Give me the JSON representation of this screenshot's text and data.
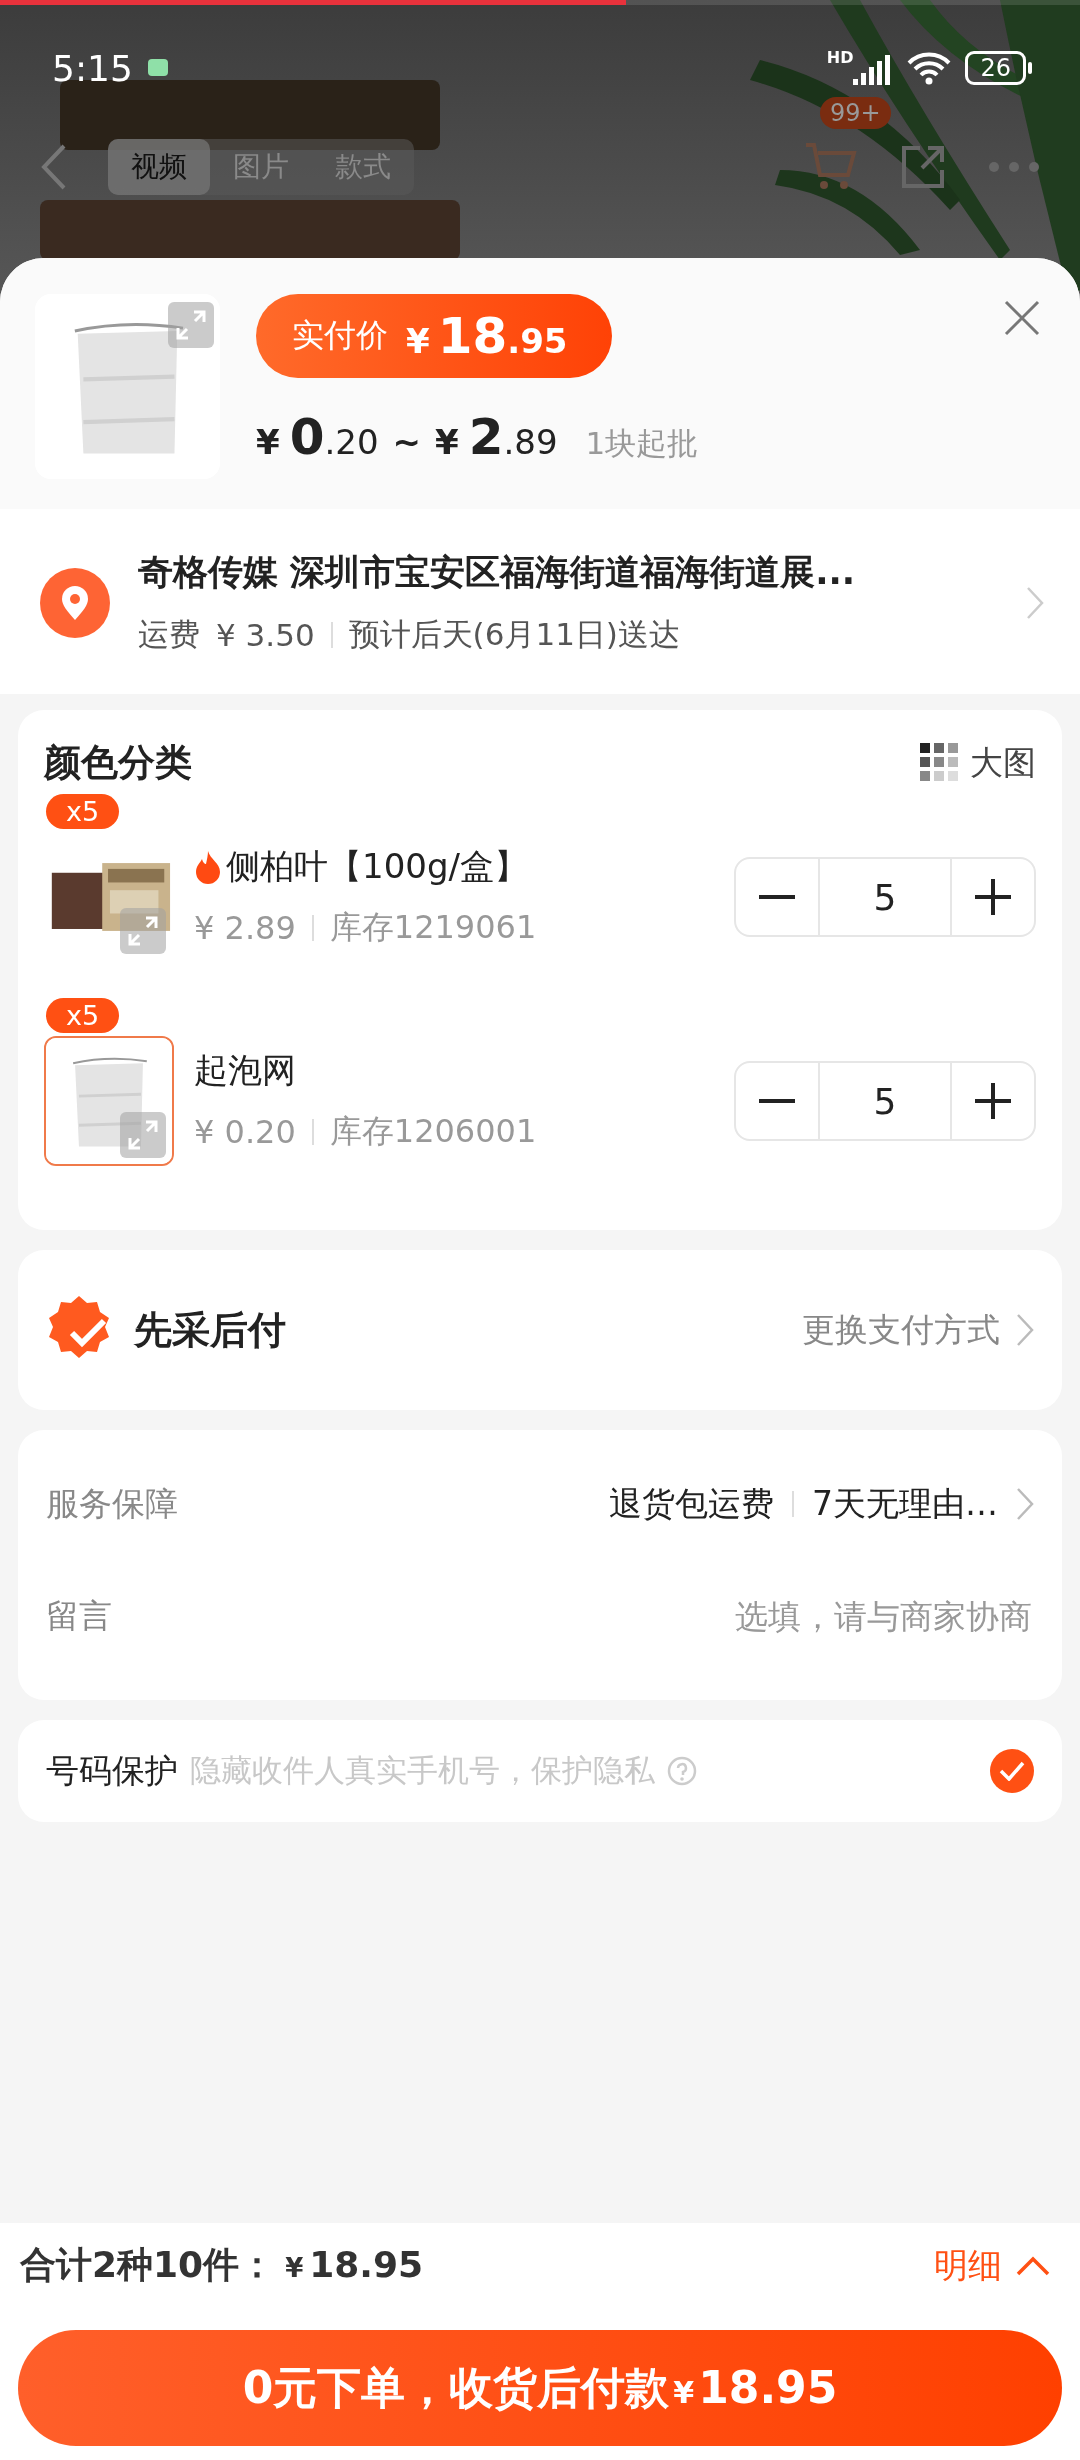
{
  "video_progress": {
    "level": 0.58
  },
  "status_bar": {
    "time": "5:15",
    "network": "HD",
    "battery": "26"
  },
  "media_tabs": [
    {
      "label": "视频",
      "selected": true
    },
    {
      "label": "图片",
      "selected": false
    },
    {
      "label": "款式",
      "selected": false
    }
  ],
  "cart_badge": "99+",
  "product": {
    "pay_label": "实付价",
    "pay_currency": "¥",
    "pay_int": "18",
    "pay_dec": ".95",
    "price_low": {
      "currency": "¥",
      "int": "0",
      "dec": ".20"
    },
    "range_sep": "~",
    "price_high": {
      "currency": "¥",
      "int": "2",
      "dec": ".89"
    },
    "min_order": "1块起批"
  },
  "address": {
    "text": "奇格传媒 深圳市宝安区福海街道福海街道展...",
    "shipping_label": "运费",
    "shipping_fee": "¥ 3.50",
    "eta": "预计后天(6月11日)送达"
  },
  "variants": {
    "title": "颜色分类",
    "view_toggle": "大图",
    "items": [
      {
        "badge": "x5",
        "hot": true,
        "name": "侧柏叶【100g/盒】",
        "price": "¥ 2.89",
        "stock": "库存1219061",
        "qty": "5",
        "selected": false
      },
      {
        "badge": "x5",
        "hot": false,
        "name": "起泡网",
        "price": "¥ 0.20",
        "stock": "库存1206001",
        "qty": "5",
        "selected": true
      }
    ]
  },
  "payment": {
    "title": "先采后付",
    "action": "更换支付方式"
  },
  "service": {
    "label": "服务保障",
    "values": [
      "退货包运费",
      "7天无理由…"
    ]
  },
  "message": {
    "label": "留言",
    "placeholder": "选填，请与商家协商"
  },
  "phone_protection": {
    "label": "号码保护",
    "hint": "隐藏收件人真实手机号，保护隐私",
    "checked": true
  },
  "footer": {
    "total_label": "合计2种10件：",
    "total_currency": "¥",
    "total": "18.95",
    "detail": "明细",
    "submit": "0元下单，收货后付款",
    "submit_currency": "¥",
    "submit_amount": "18.95"
  }
}
